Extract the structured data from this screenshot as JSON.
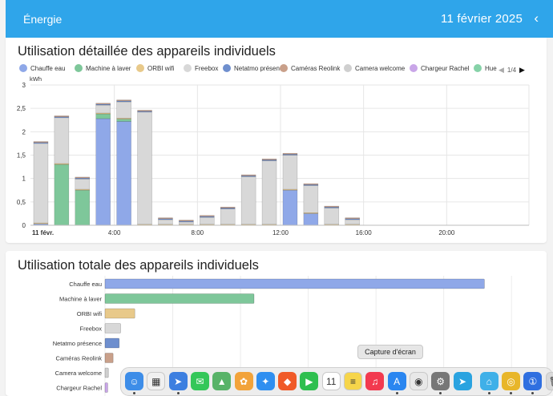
{
  "header": {
    "title": "Énergie",
    "date": "11 février 2025",
    "back_glyph": "‹"
  },
  "chart1": {
    "title": "Utilisation détaillée des appareils individuels",
    "legend_page": "1/4",
    "chart_data": {
      "type": "bar",
      "stacked": true,
      "ylabel": "kWh",
      "ylim": [
        0,
        3
      ],
      "yticks": [
        "0",
        "0,5",
        "1",
        "1,5",
        "2",
        "2,5",
        "3"
      ],
      "xticks": [
        "11 févr.",
        "4:00",
        "8:00",
        "12:00",
        "16:00",
        "20:00"
      ],
      "hours": [
        0,
        1,
        2,
        3,
        4,
        5,
        6,
        7,
        8,
        9,
        10,
        11,
        12,
        13,
        14,
        15,
        16,
        17,
        18,
        19,
        20,
        21,
        22,
        23
      ],
      "grid": true,
      "series": [
        {
          "name": "Chauffe eau",
          "color": "#8fa8e8",
          "values": [
            0.03,
            0,
            0,
            2.28,
            2.22,
            0,
            0,
            0,
            0,
            0,
            0,
            0,
            0.75,
            0.25,
            0,
            0,
            0,
            0,
            0,
            0,
            0,
            0,
            0,
            0
          ]
        },
        {
          "name": "Machine à laver",
          "color": "#7ec79a",
          "values": [
            0,
            1.3,
            0.75,
            0.1,
            0.05,
            0,
            0,
            0,
            0,
            0,
            0,
            0,
            0,
            0,
            0,
            0,
            0,
            0,
            0,
            0,
            0,
            0,
            0,
            0
          ]
        },
        {
          "name": "ORBI wifi",
          "color": "#e8c98a",
          "values": [
            0.02,
            0.02,
            0.02,
            0.02,
            0.02,
            0.02,
            0.02,
            0.02,
            0.02,
            0.02,
            0.02,
            0.02,
            0.02,
            0.02,
            0.02,
            0.02,
            0,
            0,
            0,
            0,
            0,
            0,
            0,
            0
          ]
        },
        {
          "name": "Freebox",
          "color": "#d8d8d8",
          "values": [
            1.7,
            0.98,
            0.22,
            0.17,
            0.35,
            2.4,
            0.1,
            0.05,
            0.15,
            0.33,
            1.02,
            1.36,
            0.73,
            0.58,
            0.35,
            0.1,
            0,
            0,
            0,
            0,
            0,
            0,
            0,
            0
          ]
        },
        {
          "name": "Netatmo présence",
          "color": "#6f8fce",
          "values": [
            0.02,
            0.02,
            0.02,
            0.02,
            0.02,
            0.02,
            0.02,
            0.02,
            0.02,
            0.02,
            0.02,
            0.02,
            0.02,
            0.02,
            0.02,
            0.02,
            0,
            0,
            0,
            0,
            0,
            0,
            0,
            0
          ]
        },
        {
          "name": "Caméras Reolink",
          "color": "#c9a08a",
          "values": [
            0.02,
            0.02,
            0.02,
            0.02,
            0.02,
            0.02,
            0.02,
            0.02,
            0.02,
            0.02,
            0.02,
            0.02,
            0.02,
            0.02,
            0.02,
            0.02,
            0,
            0,
            0,
            0,
            0,
            0,
            0,
            0
          ]
        },
        {
          "name": "Camera welcome",
          "color": "#cfcfcf",
          "values": [
            0,
            0,
            0,
            0,
            0,
            0,
            0,
            0,
            0,
            0,
            0,
            0,
            0,
            0,
            0,
            0,
            0,
            0,
            0,
            0,
            0,
            0,
            0,
            0
          ]
        },
        {
          "name": "Chargeur Rachel",
          "color": "#c9a6e8",
          "values": [
            0,
            0,
            0,
            0,
            0,
            0,
            0,
            0,
            0,
            0,
            0,
            0,
            0,
            0,
            0,
            0,
            0,
            0,
            0,
            0,
            0,
            0,
            0,
            0
          ]
        },
        {
          "name": "Hue iris",
          "color": "#86d2a8",
          "values": [
            0,
            0,
            0,
            0,
            0,
            0,
            0,
            0,
            0,
            0,
            0,
            0,
            0,
            0,
            0,
            0,
            0,
            0,
            0,
            0,
            0,
            0,
            0,
            0
          ]
        }
      ]
    }
  },
  "chart2": {
    "title": "Utilisation totale des appareils individuels",
    "chart_data": {
      "type": "bar",
      "orientation": "horizontal",
      "categories": [
        "Chauffe eau",
        "Machine à laver",
        "ORBI wifi",
        "Freebox",
        "Netatmo présence",
        "Caméras Reolink",
        "Camera welcome",
        "Chargeur Rachel"
      ],
      "values": [
        5.6,
        2.2,
        0.44,
        0.23,
        0.21,
        0.12,
        0.05,
        0.04
      ],
      "colors": [
        "#8fa8e8",
        "#7ec79a",
        "#e8c98a",
        "#d8d8d8",
        "#6f8fce",
        "#c9a08a",
        "#cfcfcf",
        "#c9a6e8"
      ],
      "xlim": [
        0,
        6.4
      ],
      "grid": true
    }
  },
  "tooltip": {
    "text": "Capture d'écran"
  },
  "dock": {
    "icons": [
      {
        "name": "finder-icon",
        "color": "#3d8de8",
        "glyph": "☺",
        "running": true
      },
      {
        "name": "launchpad-icon",
        "color": "#f0f0f0",
        "glyph": "▦",
        "running": false
      },
      {
        "name": "safari-nav-icon",
        "color": "#3d7fe0",
        "glyph": "➤",
        "running": true
      },
      {
        "name": "messages-icon",
        "color": "#34c759",
        "glyph": "✉",
        "running": false
      },
      {
        "name": "maps-icon",
        "color": "#58b368",
        "glyph": "▲",
        "running": false
      },
      {
        "name": "photos-icon",
        "color": "#f2a33a",
        "glyph": "✿",
        "running": false
      },
      {
        "name": "safari-icon",
        "color": "#2f8ff0",
        "glyph": "✦",
        "running": false
      },
      {
        "name": "brave-icon",
        "color": "#f05a28",
        "glyph": "◆",
        "running": false
      },
      {
        "name": "facetime-icon",
        "color": "#2fbf4f",
        "glyph": "▶",
        "running": false
      },
      {
        "name": "calendar-icon",
        "color": "#ffffff",
        "glyph": "11",
        "running": false
      },
      {
        "name": "notes-icon",
        "color": "#f6d54a",
        "glyph": "≡",
        "running": false
      },
      {
        "name": "music-icon",
        "color": "#f23a4f",
        "glyph": "♫",
        "running": false
      },
      {
        "name": "app-store-icon",
        "color": "#2a86f0",
        "glyph": "A",
        "running": true
      },
      {
        "name": "screenshot-icon",
        "color": "#e8e8e8",
        "glyph": "◉",
        "running": false
      },
      {
        "name": "system-settings-icon",
        "color": "#777777",
        "glyph": "⚙",
        "running": true
      },
      {
        "name": "telegram-icon",
        "color": "#2aa3e0",
        "glyph": "➤",
        "running": false
      },
      {
        "name": "home-assistant-icon",
        "color": "#3fb0e8",
        "glyph": "⌂",
        "running": true
      },
      {
        "name": "chrome-icon",
        "color": "#e8b62a",
        "glyph": "◎",
        "running": true
      },
      {
        "name": "onepassword-icon",
        "color": "#2f6fe0",
        "glyph": "①",
        "running": true
      },
      {
        "name": "trash-icon",
        "color": "#d9d9d9",
        "glyph": "🗑",
        "running": false
      }
    ]
  }
}
